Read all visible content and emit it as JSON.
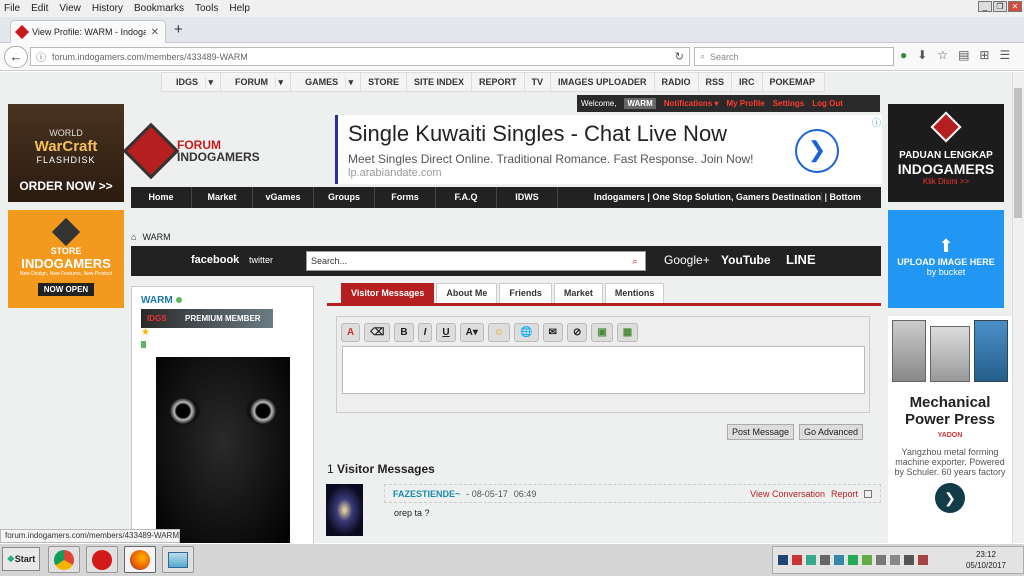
{
  "menubar": {
    "items": [
      "File",
      "Edit",
      "View",
      "History",
      "Bookmarks",
      "Tools",
      "Help"
    ]
  },
  "browser": {
    "tab_title": "View Profile: WARM - Indogamers",
    "url": "forum.indogamers.com/members/433489-WARM",
    "search_placeholder": "Search"
  },
  "topnav": {
    "items": [
      "IDGS",
      "FORUM",
      "GAMES",
      "STORE",
      "SITE INDEX",
      "REPORT",
      "TV",
      "IMAGES UPLOADER",
      "RADIO",
      "RSS",
      "IRC",
      "POKEMAP"
    ]
  },
  "userbar": {
    "welcome": "Welcome,",
    "username": "WARM",
    "notifications": "Notifications",
    "my_profile": "My Profile",
    "settings": "Settings",
    "logout": "Log Out"
  },
  "ads": {
    "left1": {
      "line1": "WORLD",
      "line2": "WarCraft",
      "line3": "FLASHDISK",
      "cta": "ORDER NOW >>"
    },
    "left2": {
      "line1": "STORE",
      "line2": "INDOGAMERS",
      "line3": "New Design, New Features, New Product",
      "cta": "NOW OPEN"
    },
    "right1": {
      "line1": "PADUAN LENGKAP",
      "line2": "INDOGAMERS",
      "cta": "Klik Disini >>"
    },
    "right2": {
      "line1": "UPLOAD IMAGE HERE",
      "line2": "bucket"
    },
    "right3": {
      "title": "Mechanical Power Press",
      "brand": "YADON",
      "desc": "Yangzhou metal forming machine exporter. Powered by Schuler. 60 years factory"
    },
    "banner": {
      "headline": "Single Kuwaiti Singles - Chat Live Now",
      "subline": "Meet Singles Direct Online. Traditional Romance. Fast Response. Join Now!",
      "url": "lp.arabiandate.com"
    }
  },
  "logo": {
    "line1": "FORUM",
    "line2": "INDOGAMERS"
  },
  "mainnav": {
    "items": [
      "Home",
      "Market",
      "vGames",
      "Groups",
      "Forms",
      "F.A.Q",
      "IDWS"
    ],
    "tagline": "Indogamers | One Stop Solution, Gamers Destination",
    "bottom": "Bottom"
  },
  "breadcrumb": {
    "current": "WARM"
  },
  "social": {
    "facebook": "facebook",
    "twitter": "twitter",
    "search_placeholder": "Search...",
    "google": "Google+",
    "youtube": "YouTube",
    "line": "LINE"
  },
  "profile": {
    "username": "WARM",
    "badge": "PREMIUM MEMBER",
    "badge_prefix": "IDGS"
  },
  "tabs": [
    "Visitor Messages",
    "About Me",
    "Friends",
    "Market",
    "Mentions"
  ],
  "editor": {
    "post_button": "Post Message",
    "advanced_button": "Go Advanced"
  },
  "messages": {
    "count": "1",
    "title": "Visitor Messages",
    "items": [
      {
        "author": "FAZESTIENDE~",
        "date": "- 08-05-17",
        "time": "06:49",
        "view": "View Conversation",
        "report": "Report",
        "text": "orep ta ?"
      }
    ]
  },
  "status": {
    "link_hover": "forum.indogamers.com/members/433489-WARM"
  },
  "taskbar": {
    "start": "Start",
    "time": "23:12",
    "date": "05/10/2017"
  }
}
